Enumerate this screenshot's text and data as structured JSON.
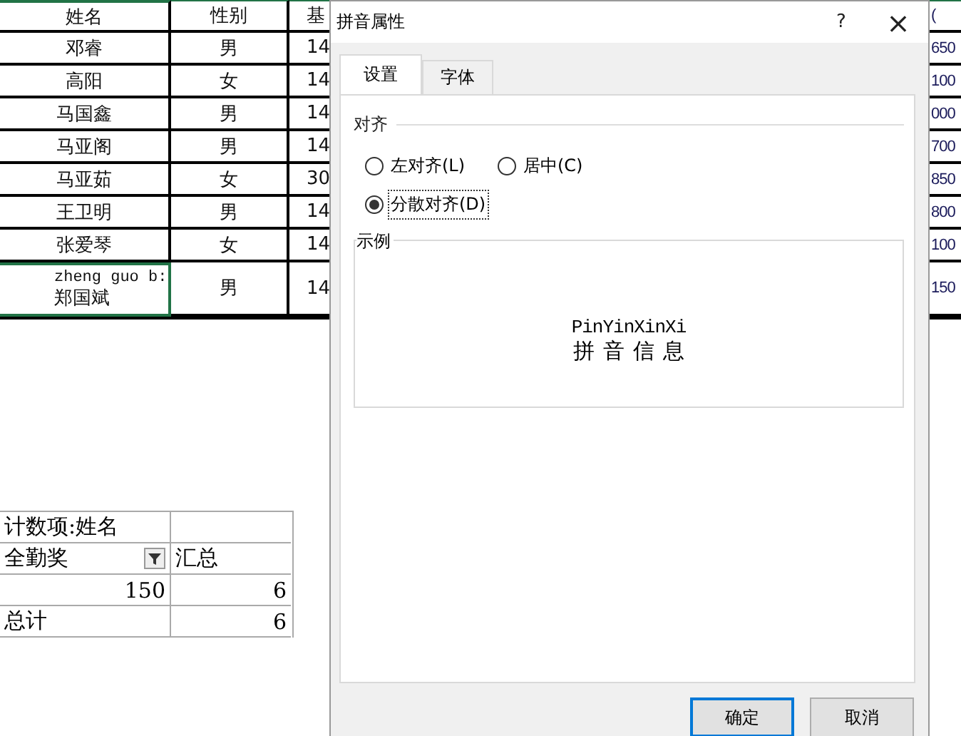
{
  "sheet": {
    "columns": [
      "姓名",
      "性别",
      "基",
      "("
    ],
    "rows": [
      {
        "name": "邓睿",
        "gender": "男",
        "column_3": "14",
        "column_4": "650",
        "selected": false
      },
      {
        "name": "高阳",
        "gender": "女",
        "column_3": "14",
        "column_4": "100",
        "selected": false
      },
      {
        "name": "马国鑫",
        "gender": "男",
        "column_3": "14",
        "column_4": "000",
        "selected": false
      },
      {
        "name": "马亚阁",
        "gender": "男",
        "column_3": "14",
        "column_4": "700",
        "selected": false
      },
      {
        "name": "马亚茹",
        "gender": "女",
        "column_3": "30",
        "column_4": "850",
        "selected": false
      },
      {
        "name": "王卫明",
        "gender": "男",
        "column_3": "14",
        "column_4": "800",
        "selected": false
      },
      {
        "name": "张爱琴",
        "gender": "女",
        "column_3": "14",
        "column_4": "100",
        "selected": false
      },
      {
        "phonetic": "zheng guo b:",
        "name": "郑国斌",
        "gender": "男",
        "column_3": "14",
        "column_4": "150",
        "selected": true
      }
    ]
  },
  "pivot": {
    "title": "计数项:姓名",
    "row_field": "全勤奖",
    "value_header": "汇总",
    "rows": [
      {
        "label": "",
        "value": "6",
        "kind": "item",
        "key": "150"
      },
      {
        "label": "总计",
        "value": "6",
        "kind": "total"
      }
    ]
  },
  "dialog": {
    "title": "拼音属性",
    "help": "?",
    "close": "×",
    "tabs": [
      {
        "label": "设置",
        "selected": true
      },
      {
        "label": "字体",
        "selected": false
      }
    ],
    "align_group": "对齐",
    "options": [
      {
        "label": "左对齐(L)",
        "selected": false
      },
      {
        "label": "居中(C)",
        "selected": false
      },
      {
        "label": "分散对齐(D)",
        "selected": true
      }
    ],
    "sample_group": "示例",
    "sample": {
      "pinyin": "PinYinXinXi",
      "text": "拼音信息"
    },
    "buttons": [
      {
        "label": "确定",
        "default": true
      },
      {
        "label": "取消",
        "default": false
      }
    ]
  }
}
